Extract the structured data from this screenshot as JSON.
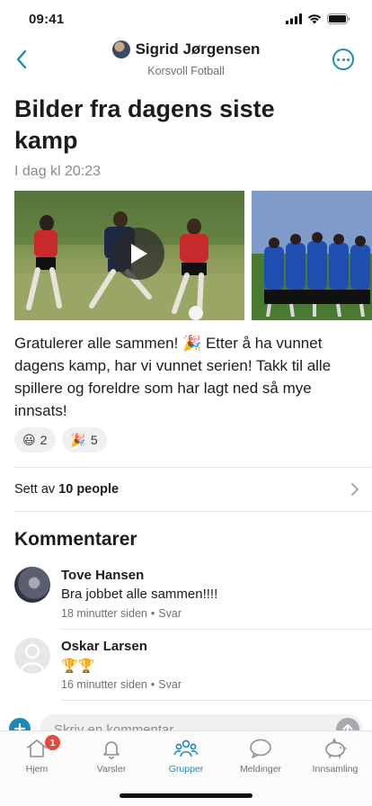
{
  "status_bar": {
    "time": "09:41"
  },
  "header": {
    "author": "Sigrid Jørgensen",
    "group": "Korsvoll Fotball"
  },
  "post": {
    "title": "Bilder fra dagens siste kamp",
    "timestamp": "I dag kl 20:23",
    "body": "Gratulerer alle sammen! 🎉 Etter å ha vunnet dagens kamp, har vi vunnet serien! Takk til alle spillere og foreldre som har lagt ned så mye innsats!",
    "reactions": [
      {
        "emoji": "😃",
        "count": "2"
      },
      {
        "emoji": "🎉",
        "count": "5"
      }
    ],
    "seen_prefix": "Sett av",
    "seen_count": "10 people"
  },
  "comments": {
    "title": "Kommentarer",
    "items": [
      {
        "name": "Tove Hansen",
        "text": "Bra jobbet alle sammen!!!!",
        "time": "18 minutter siden",
        "reply": "Svar"
      },
      {
        "name": "Oskar Larsen",
        "text": "🏆🏆",
        "time": "16 minutter siden",
        "reply": "Svar"
      }
    ],
    "separator": "•"
  },
  "composer": {
    "placeholder": "Skriv en kommentar..."
  },
  "tabbar": {
    "items": [
      {
        "label": "Hjem",
        "badge": "1"
      },
      {
        "label": "Varsler"
      },
      {
        "label": "Grupper"
      },
      {
        "label": "Meldinger"
      },
      {
        "label": "Innsamling"
      }
    ],
    "active": "Grupper"
  },
  "colors": {
    "accent": "#1b8ab7",
    "badge": "#e5483d",
    "muted": "#8a8a8f"
  }
}
